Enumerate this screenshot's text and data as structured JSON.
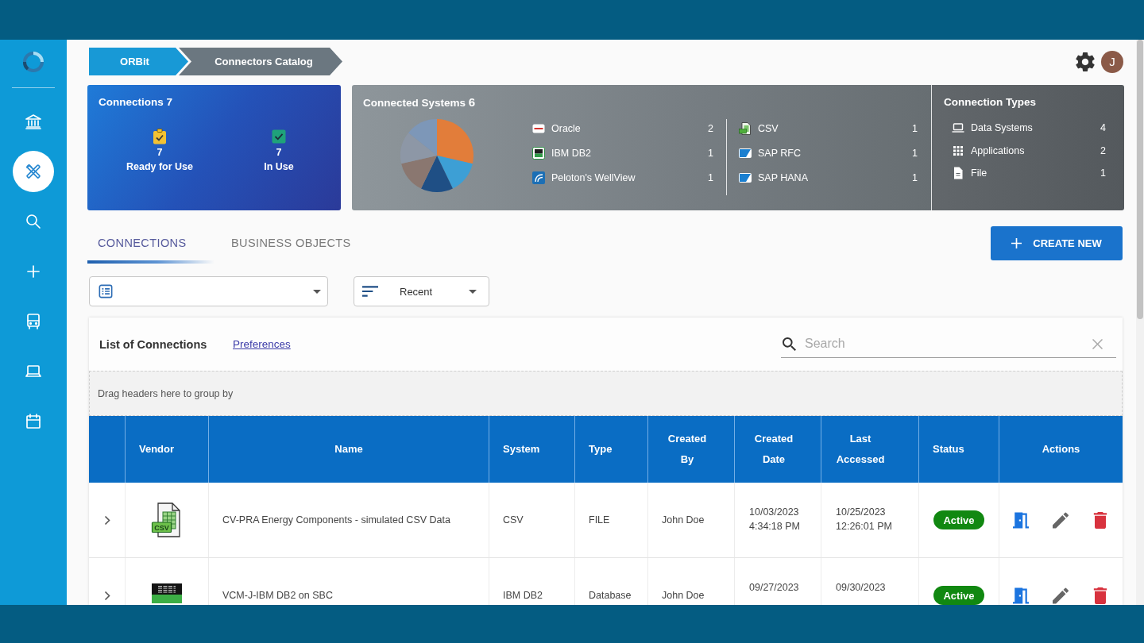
{
  "sidebar": {
    "items": [
      {
        "selected": false
      },
      {
        "selected": true
      },
      {
        "selected": false
      },
      {
        "selected": false
      },
      {
        "selected": false
      },
      {
        "selected": false
      },
      {
        "selected": false
      }
    ]
  },
  "breadcrumb": [
    {
      "label": "ORBit"
    },
    {
      "label": "Connectors Catalog"
    }
  ],
  "user": {
    "initial": "J"
  },
  "summary": {
    "connections": {
      "title": "Connections",
      "count": "7",
      "stats": [
        {
          "kind": "ready",
          "value": "7",
          "label": "Ready for Use"
        },
        {
          "kind": "in_use",
          "value": "7",
          "label": "In Use"
        }
      ]
    },
    "connected_systems": {
      "title": "Connected Systems",
      "count": "6",
      "chart_data": {
        "type": "pie",
        "values": [
          28.57,
          14.29,
          14.29,
          14.29,
          14.28,
          14.28
        ]
      },
      "items": [
        {
          "kind": "oracle",
          "name": "Oracle",
          "count": "2"
        },
        {
          "kind": "db2",
          "name": "IBM DB2",
          "count": "1"
        },
        {
          "kind": "wellview",
          "name": "Peloton's WellView",
          "count": "1"
        },
        {
          "kind": "csv",
          "name": "CSV",
          "count": "1"
        },
        {
          "kind": "sap",
          "name": "SAP RFC",
          "count": "1"
        },
        {
          "kind": "sap",
          "name": "SAP HANA",
          "count": "1"
        }
      ]
    },
    "connection_types": {
      "title": "Connection Types",
      "items": [
        {
          "kind": "data_systems",
          "name": "Data Systems",
          "count": "4"
        },
        {
          "kind": "applications",
          "name": "Applications",
          "count": "2"
        },
        {
          "kind": "file",
          "name": "File",
          "count": "1"
        }
      ]
    }
  },
  "tabs": [
    {
      "label": "CONNECTIONS",
      "selected": true
    },
    {
      "label": "BUSINESS OBJECTS",
      "selected": false
    }
  ],
  "create_button": {
    "label": "CREATE NEW"
  },
  "filters": {
    "sort": {
      "value": "Recent"
    }
  },
  "list": {
    "title": "List of Connections",
    "link": "Preferences",
    "search": {
      "placeholder": "Search"
    },
    "group_hint": "Drag headers here to group by"
  },
  "table": {
    "columns": [
      "Vendor",
      "Name",
      "System",
      "Type",
      "Created By",
      "Created Date",
      "Last Accessed",
      "Status",
      "Actions"
    ],
    "rows": [
      {
        "expanded": false,
        "vendor": {
          "kind": "csv",
          "logo_text": "CSV"
        },
        "name": "CV-PRA Energy Components - simulated CSV Data",
        "system": "CSV",
        "type": "FILE",
        "created_by": "John Doe",
        "created_date": [
          "10/03/2023",
          "4:34:18 PM"
        ],
        "last_accessed": [
          "10/25/2023",
          "12:26:01 PM"
        ],
        "status": {
          "kind": "active",
          "label": "Active"
        }
      },
      {
        "expanded": false,
        "vendor": {
          "kind": "db2"
        },
        "name": "VCM-J-IBM DB2 on SBC",
        "system": "IBM DB2",
        "type": "Database",
        "created_by": "John Doe",
        "created_date": [
          "09/27/2023"
        ],
        "last_accessed": [
          "09/30/2023"
        ],
        "status": {
          "kind": "active",
          "label": "Active"
        }
      }
    ]
  }
}
